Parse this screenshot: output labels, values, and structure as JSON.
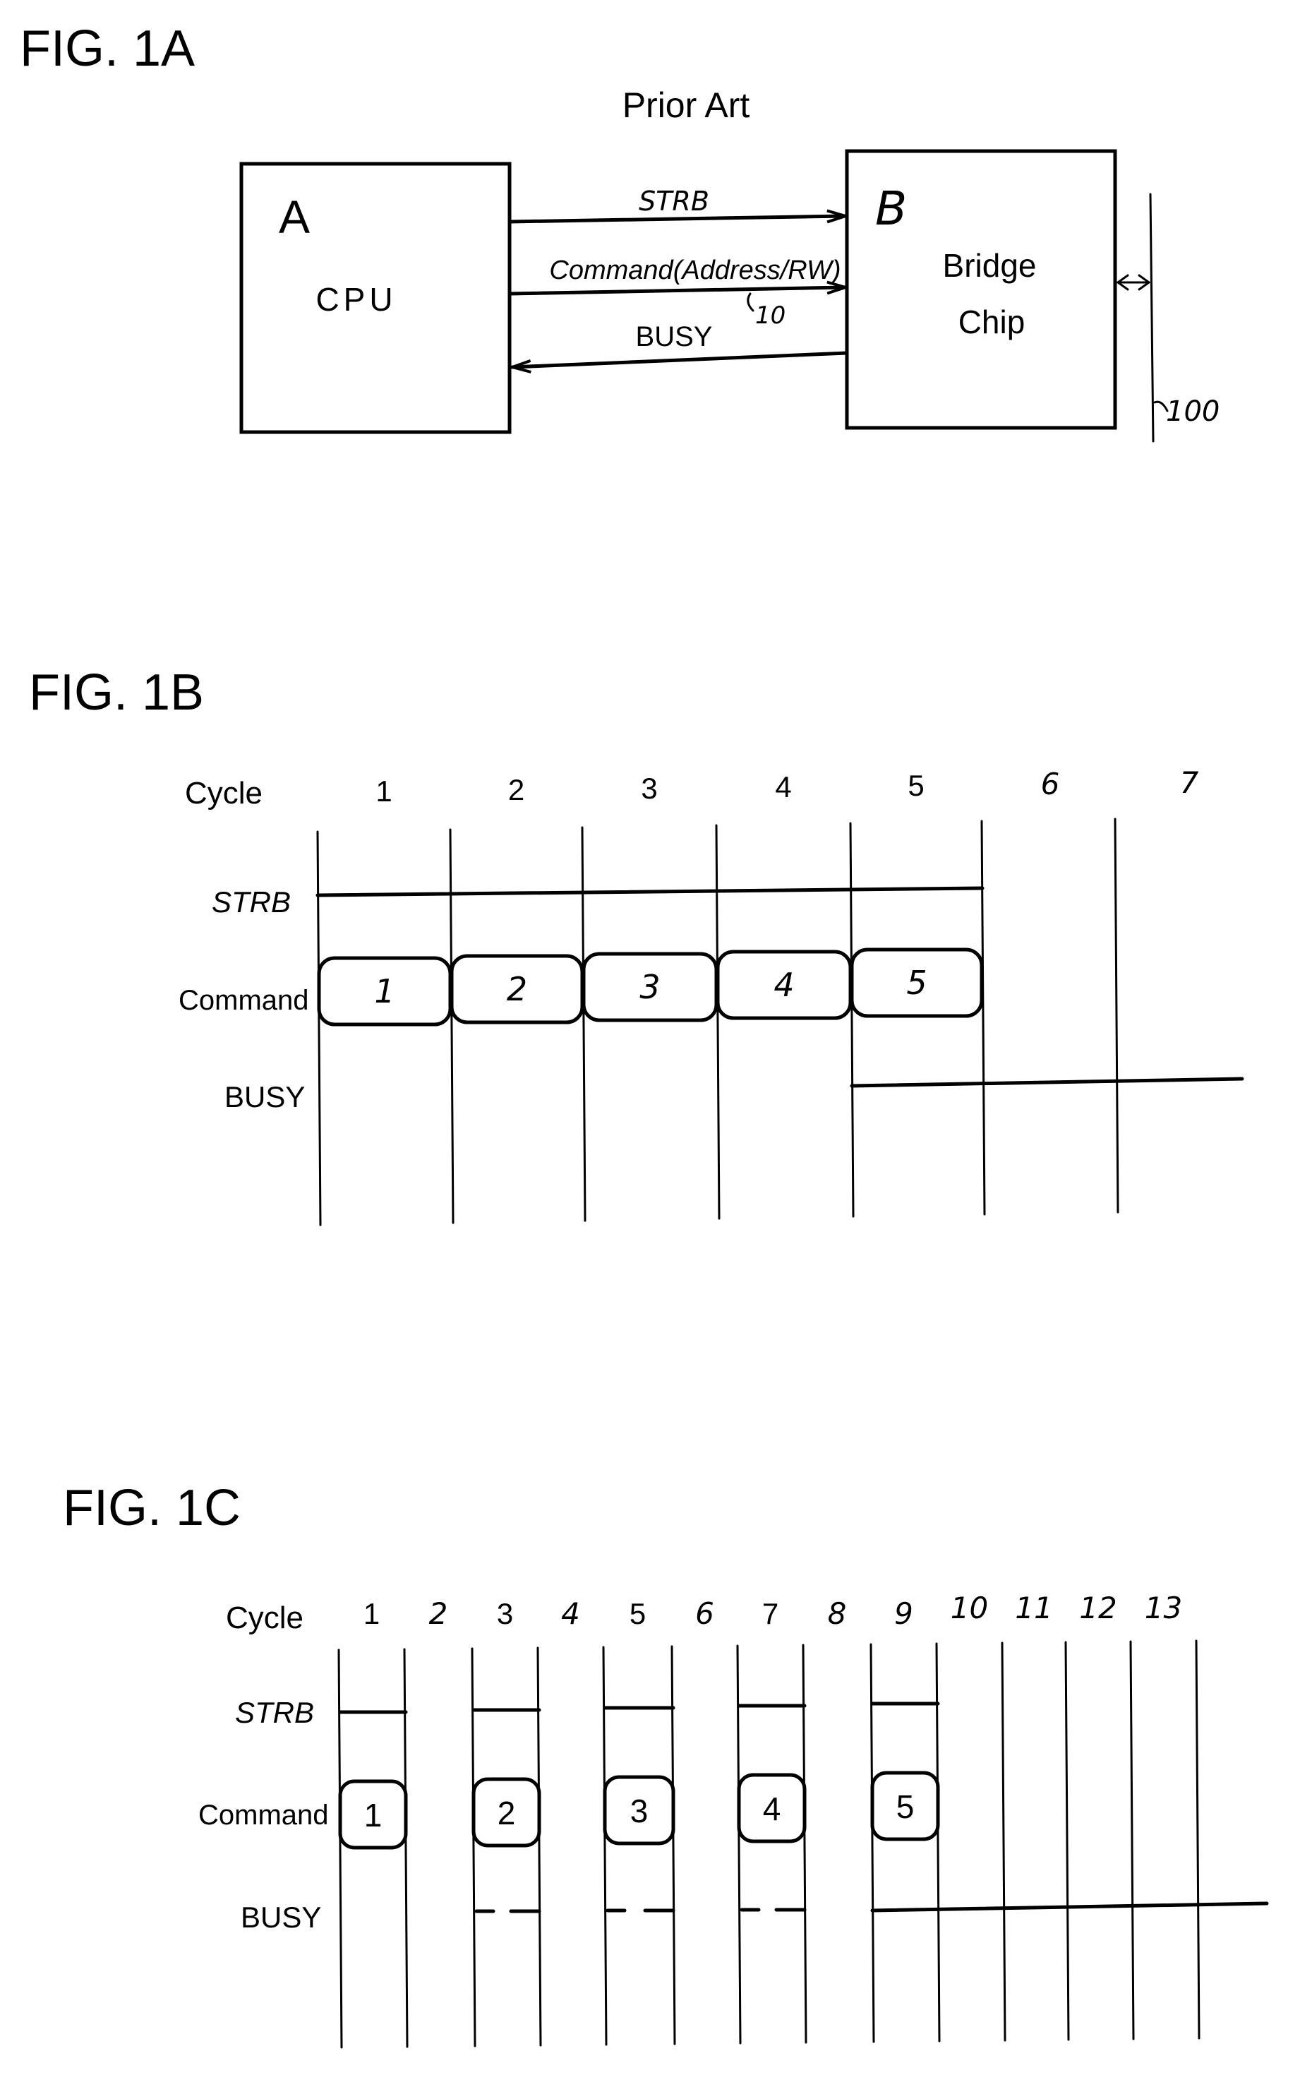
{
  "fig1a": {
    "label": "FIG.  1A",
    "subtitle": "Prior Art",
    "cpu": {
      "letter": "A",
      "name": "CPU"
    },
    "bridge": {
      "letter": "B",
      "line1": "Bridge",
      "line2": "Chip"
    },
    "signals": {
      "strb": "STRB",
      "command": "Command(Address/RW)",
      "busy": "BUSY"
    },
    "refs": {
      "command_ref": "10",
      "bus_ref": "100"
    }
  },
  "fig1b": {
    "label": "FIG.  1B",
    "row_labels": {
      "cycle": "Cycle",
      "strb": "STRB",
      "command": "Command",
      "busy": "BUSY"
    },
    "cycles": [
      "1",
      "2",
      "3",
      "4",
      "5",
      "6",
      "7"
    ],
    "commands": [
      "1",
      "2",
      "3",
      "4",
      "5"
    ]
  },
  "fig1c": {
    "label": "FIG.  1C",
    "row_labels": {
      "cycle": "Cycle",
      "strb": "STRB",
      "command": "Command",
      "busy": "BUSY"
    },
    "cycles": [
      "1",
      "2",
      "3",
      "4",
      "5",
      "6",
      "7",
      "8",
      "9",
      "10",
      "11",
      "12",
      "13"
    ],
    "commands": [
      "1",
      "2",
      "3",
      "4",
      "5"
    ]
  }
}
